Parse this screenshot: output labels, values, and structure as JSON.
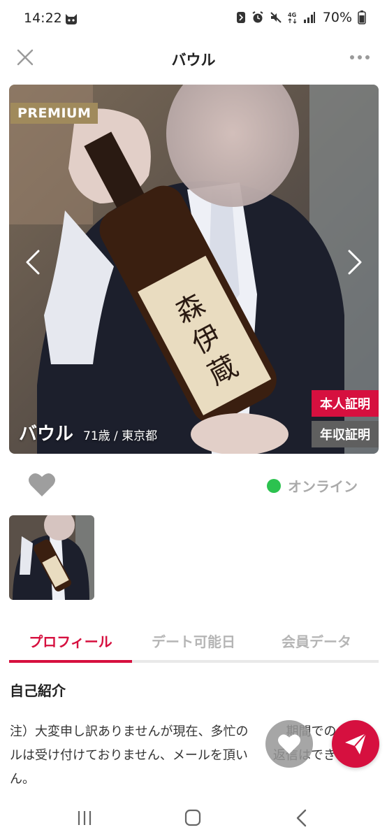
{
  "status_bar": {
    "time": "14:22",
    "network": "4G",
    "battery": "70%"
  },
  "header": {
    "title": "バウル"
  },
  "profile": {
    "premium_badge": "PREMIUM",
    "name": "バウル",
    "meta": "71歳 / 東京都",
    "verify_id": "本人証明",
    "verify_income": "年収証明",
    "online_status": "オンライン"
  },
  "tabs": [
    {
      "label": "プロフィール",
      "active": true
    },
    {
      "label": "デート可能日",
      "active": false
    },
    {
      "label": "会員データ",
      "active": false
    }
  ],
  "section": {
    "title": "自己紹介",
    "intro": "注）大変申し訳ありませんが現在、多忙の　　　期間でのメールは受け付けておりません、メールを頂い　　返信はできません。"
  },
  "colors": {
    "accent": "#d6103f",
    "premium": "#a08a5c",
    "online": "#2cc24f"
  },
  "icons": [
    "close-icon",
    "more-icon",
    "chevron-left-icon",
    "chevron-right-icon",
    "heart-icon",
    "paper-plane-icon",
    "recents-icon",
    "home-icon",
    "back-icon"
  ]
}
